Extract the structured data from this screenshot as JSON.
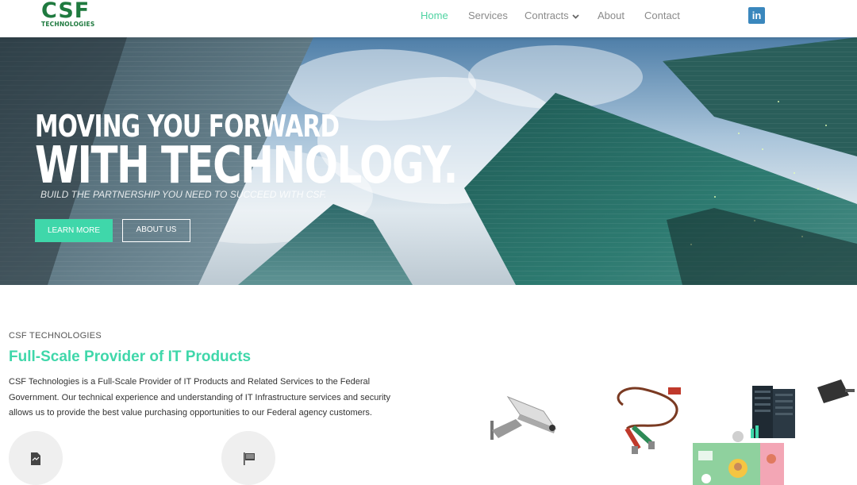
{
  "brand": {
    "name": "CSF",
    "sub": "TECHNOLOGIES",
    "color": "#1f7a3f"
  },
  "nav": {
    "items": [
      {
        "label": "Home",
        "active": true
      },
      {
        "label": "Services",
        "active": false
      },
      {
        "label": "Contracts",
        "active": false,
        "has_dropdown": true
      },
      {
        "label": "About",
        "active": false
      },
      {
        "label": "Contact",
        "active": false
      }
    ],
    "social_icon": "linkedin-icon",
    "social_label": "in"
  },
  "hero": {
    "line1": "MOVING YOU FORWARD",
    "line2": "WITH TECHNOLOGY.",
    "subtitle": "BUILD THE PARTNERSHIP YOU NEED TO SUCCEED WITH CSF.",
    "primary_button": "LEARN MORE",
    "secondary_button": "ABOUT US"
  },
  "intro": {
    "eyebrow": "CSF TECHNOLOGIES",
    "headline": "Full-Scale Provider of IT Products",
    "paragraph": "CSF Technologies is a Full-Scale Provider of IT Products and Related Services to the Federal Government. Our technical experience and understanding of IT Infrastructure services and security allows us to provide the best value purchasing opportunities to our Federal agency customers."
  },
  "feature_icons": [
    "document-icon",
    "flag-icon"
  ],
  "colors": {
    "accent": "#3fd7aa",
    "nav_text": "#8a8a8a",
    "linkedin": "#3a87bd"
  }
}
